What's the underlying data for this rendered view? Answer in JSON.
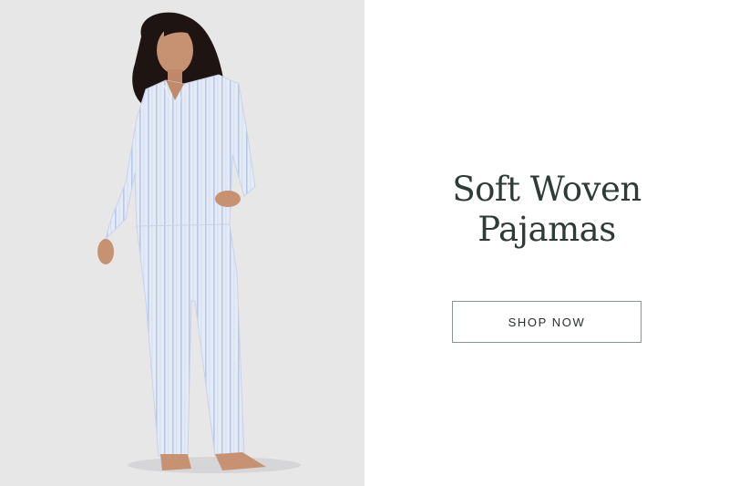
{
  "hero": {
    "image": {
      "alt": "",
      "background_color": "#e7e7e8",
      "garment_color": "#e4ebf7",
      "stripe_color": "#b9c8e6"
    },
    "headline_line1": "Soft Woven",
    "headline_line2": "Pajamas",
    "headline_color": "#2f3b38",
    "cta_label": "SHOP NOW"
  }
}
